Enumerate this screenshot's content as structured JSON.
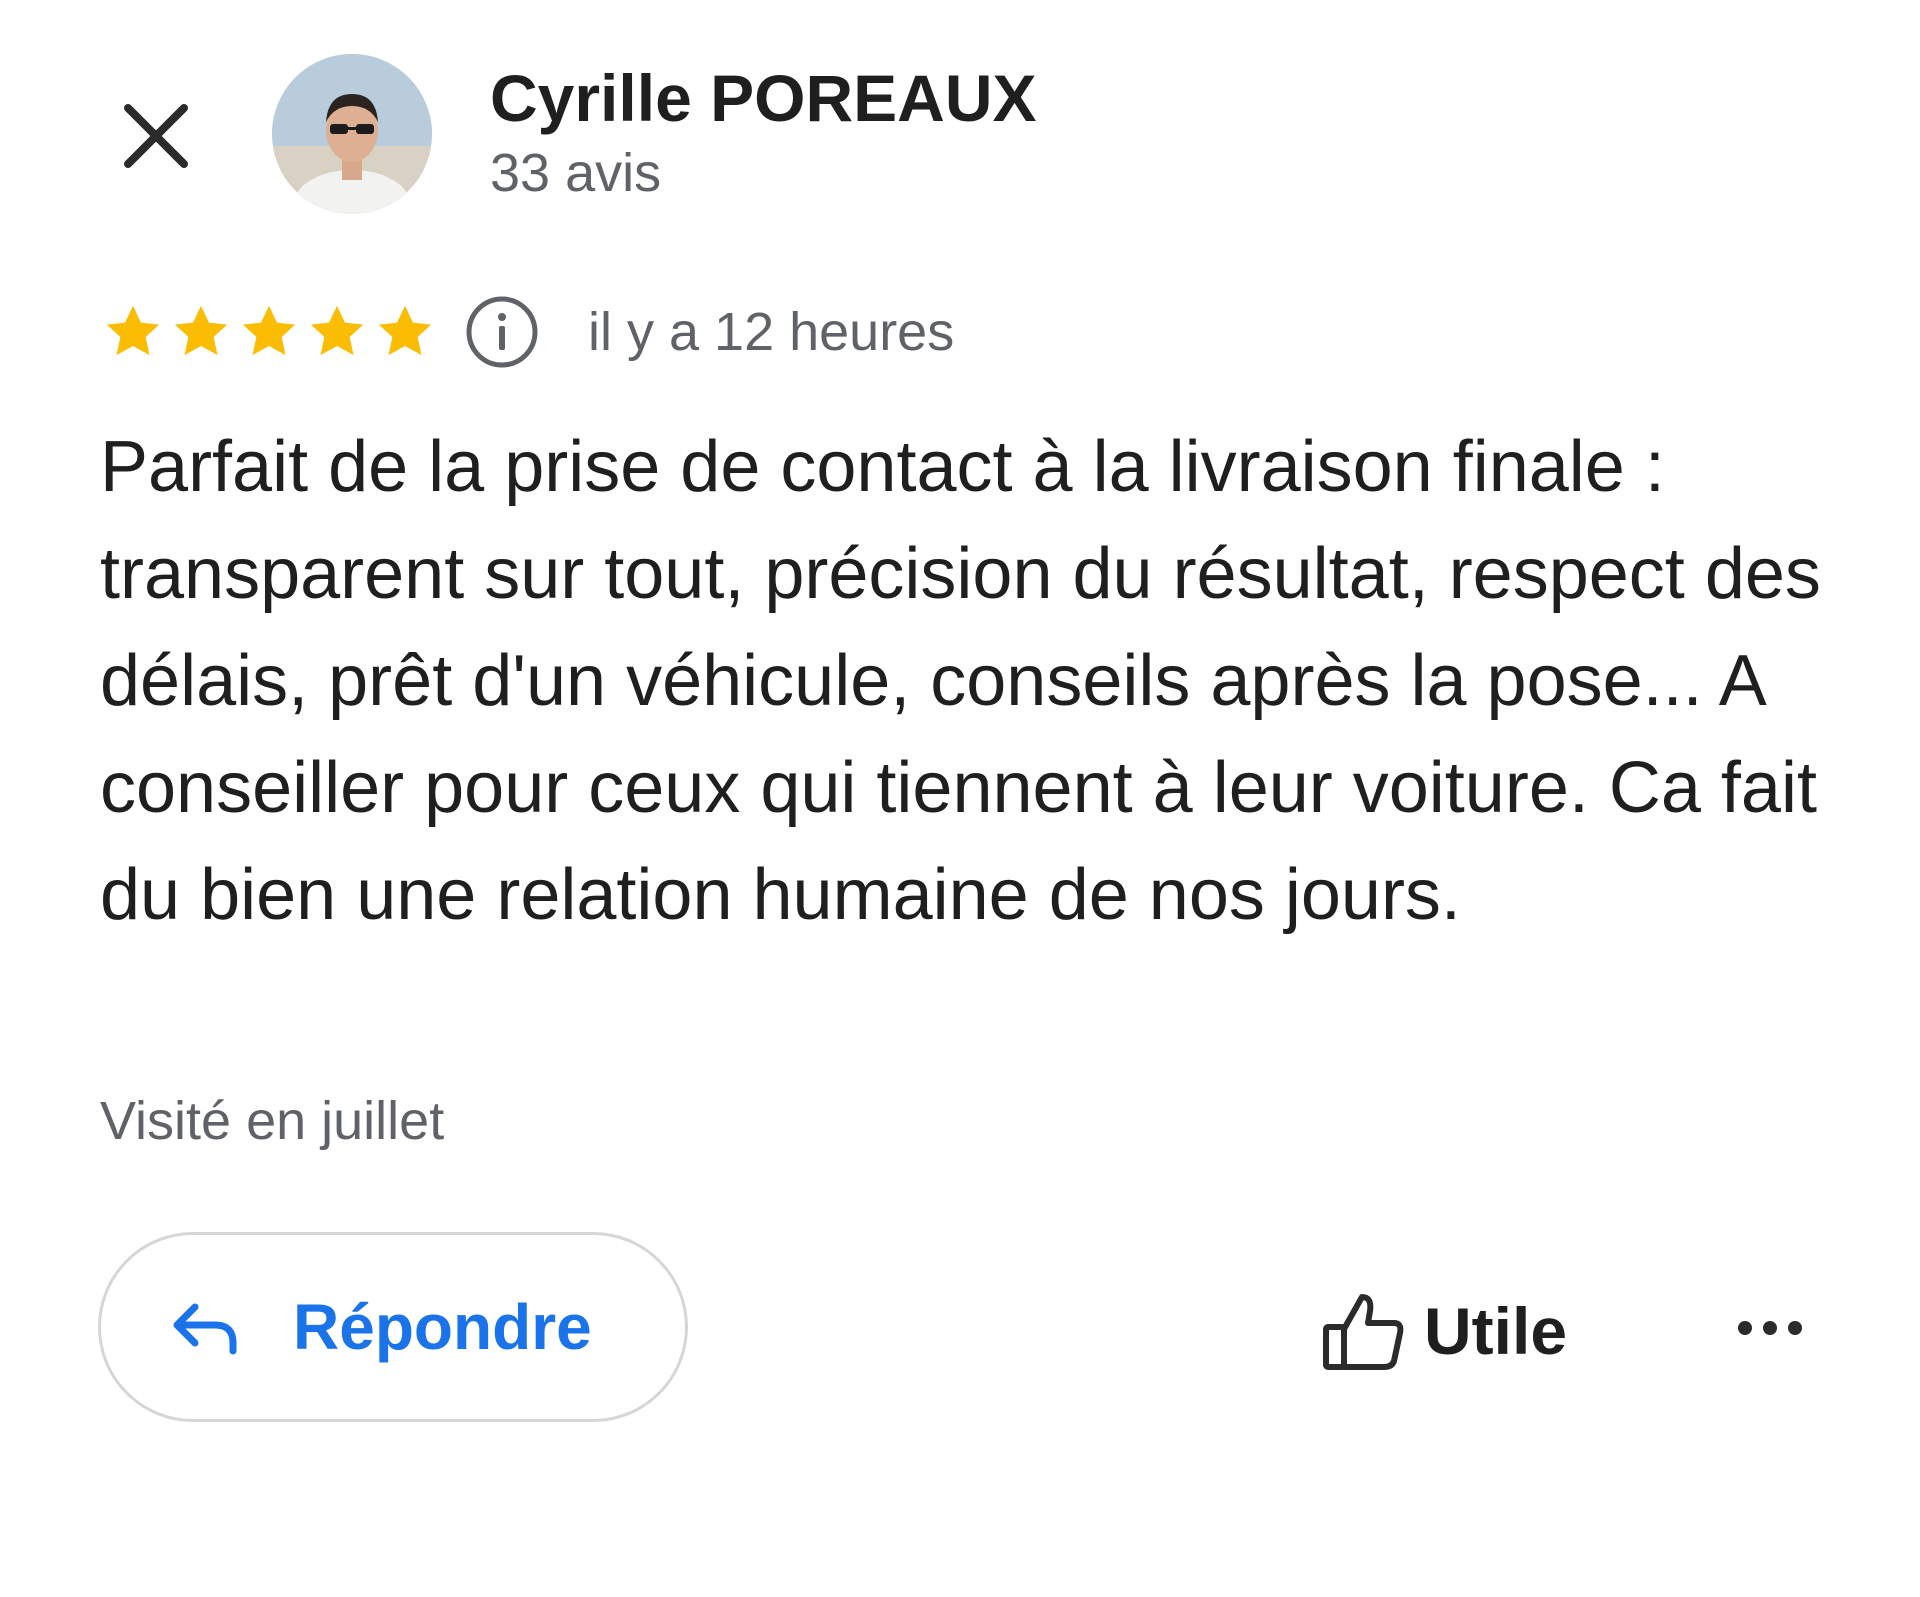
{
  "header": {
    "close_icon": "close-icon",
    "author_name": "Cyrille POREAUX",
    "review_count": "33 avis"
  },
  "rating": {
    "stars": 5,
    "max_stars": 5,
    "star_color": "#fbbc04",
    "info_icon": "info-icon",
    "time_ago": "il y a 12 heures"
  },
  "review": {
    "text": "Parfait de la prise de contact à la livraison finale : transparent sur tout, précision du résultat, respect des délais, prêt d'un véhicule, conseils après la pose... A conseiller pour ceux qui tiennent à leur voiture. Ca fait du bien une relation humaine de nos jours.",
    "visited": "Visité en juillet"
  },
  "actions": {
    "reply_label": "Répondre",
    "reply_icon": "reply-arrow-icon",
    "reply_color": "#1a73e8",
    "useful_label": "Utile",
    "useful_icon": "thumbs-up-icon",
    "more_icon": "more-horizontal-icon"
  }
}
